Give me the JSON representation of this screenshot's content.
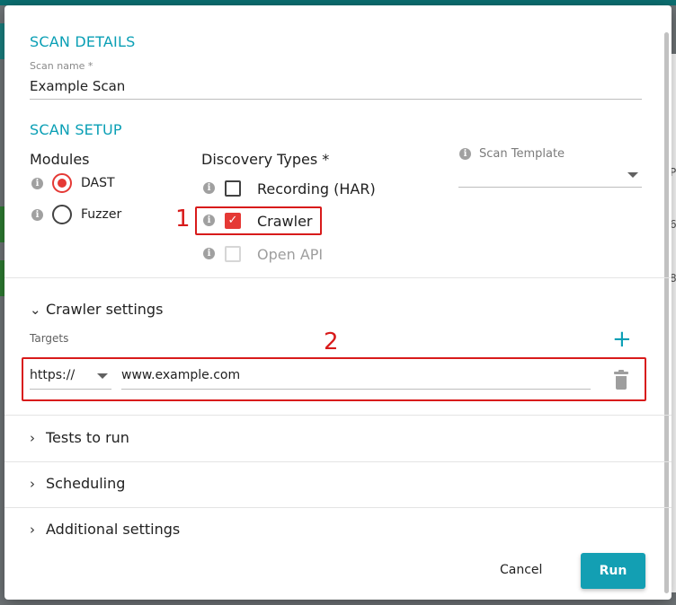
{
  "scan_details": {
    "title": "SCAN DETAILS",
    "scan_name_label": "Scan name *",
    "scan_name_value": "Example Scan"
  },
  "scan_setup": {
    "title": "SCAN SETUP",
    "modules": {
      "label": "Modules",
      "items": [
        {
          "label": "DAST",
          "selected": true
        },
        {
          "label": "Fuzzer",
          "selected": false
        }
      ]
    },
    "discovery_types": {
      "label": "Discovery Types *",
      "items": [
        {
          "label": "Recording (HAR)",
          "checked": false,
          "disabled": false
        },
        {
          "label": "Crawler",
          "checked": true,
          "disabled": false
        },
        {
          "label": "Open API",
          "checked": false,
          "disabled": true
        }
      ]
    },
    "scan_template": {
      "label": "Scan Template",
      "value": ""
    }
  },
  "crawler_settings": {
    "title": "Crawler settings",
    "targets_label": "Targets",
    "target": {
      "protocol": "https://",
      "url": "www.example.com"
    }
  },
  "collapsed_sections": [
    "Tests to run",
    "Scheduling",
    "Additional settings"
  ],
  "annotations": {
    "one": "1",
    "two": "2"
  },
  "actions": {
    "cancel": "Cancel",
    "run": "Run"
  },
  "background": {
    "right_fragments": [
      "P",
      "6",
      "8"
    ]
  },
  "colors": {
    "accent": "#0a9fb5",
    "selection": "#e53935",
    "annotation": "#d81b1b",
    "run_button": "#139fb3"
  },
  "icons": {
    "info": "info-icon",
    "check": "checkmark-icon",
    "expand": "chevron-down-icon",
    "collapse": "chevron-right-icon",
    "add": "plus-icon",
    "delete": "trash-icon",
    "select": "dropdown-arrow-icon"
  }
}
